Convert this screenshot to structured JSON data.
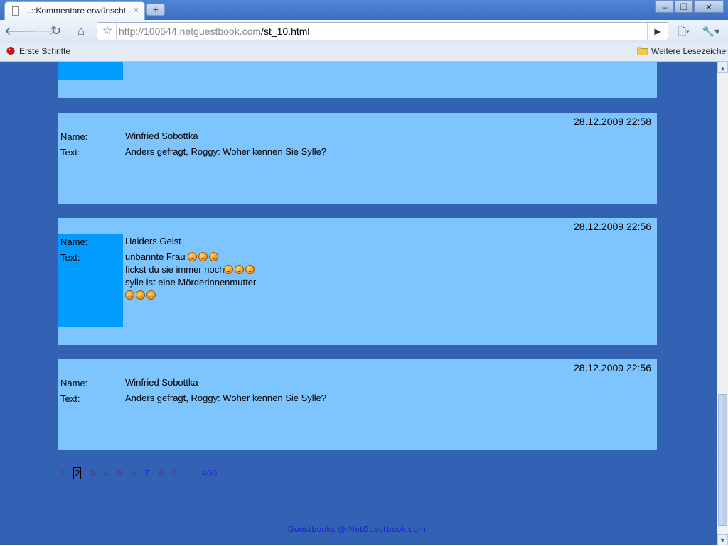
{
  "browser": {
    "tab_title": "..::Kommentare erwünscht...",
    "tab_close": "×",
    "new_tab": "+",
    "window_buttons": {
      "minimize": "–",
      "maximize": "❐",
      "close": "✕"
    },
    "url_domain": "http://100544.netguestbook.com",
    "url_path": "/st_10.html",
    "bookmarks": {
      "left": "Erste Schritte",
      "right": "Weitere Lesezeichen"
    }
  },
  "entries": [
    {
      "date": "28.12.2009 22:58",
      "name_label": "Name:",
      "name": "Winfried Sobottka",
      "text_label": "Text:",
      "text_lines": [
        "Anders gefragt, Roggy: Woher kennen Sie Sylle?"
      ]
    },
    {
      "date": "28.12.2009 22:56",
      "name_label": "Name:",
      "name": "Haiders Geist",
      "text_label": "Text:",
      "text_lines": [
        "unbannte Frau ",
        "fickst du sie immer noch",
        "sylle ist eine Mörderinnenmutter"
      ]
    },
    {
      "date": "28.12.2009 22:56",
      "name_label": "Name:",
      "name": "Winfried Sobottka",
      "text_label": "Text:",
      "text_lines": [
        "Anders gefragt, Roggy: Woher kennen Sie Sylle?"
      ]
    }
  ],
  "pagination": {
    "pages": [
      "1",
      "2",
      "3",
      "4",
      "5",
      "6",
      "7",
      "8",
      "9",
      "...",
      "400"
    ],
    "current": "2",
    "separator": "·"
  },
  "footer": "Guestbooks @ NetGuestbook.com",
  "colors": {
    "page_bg": "#3362b4",
    "entry_bg": "#7ec5ff",
    "highlight": "#009cff"
  }
}
